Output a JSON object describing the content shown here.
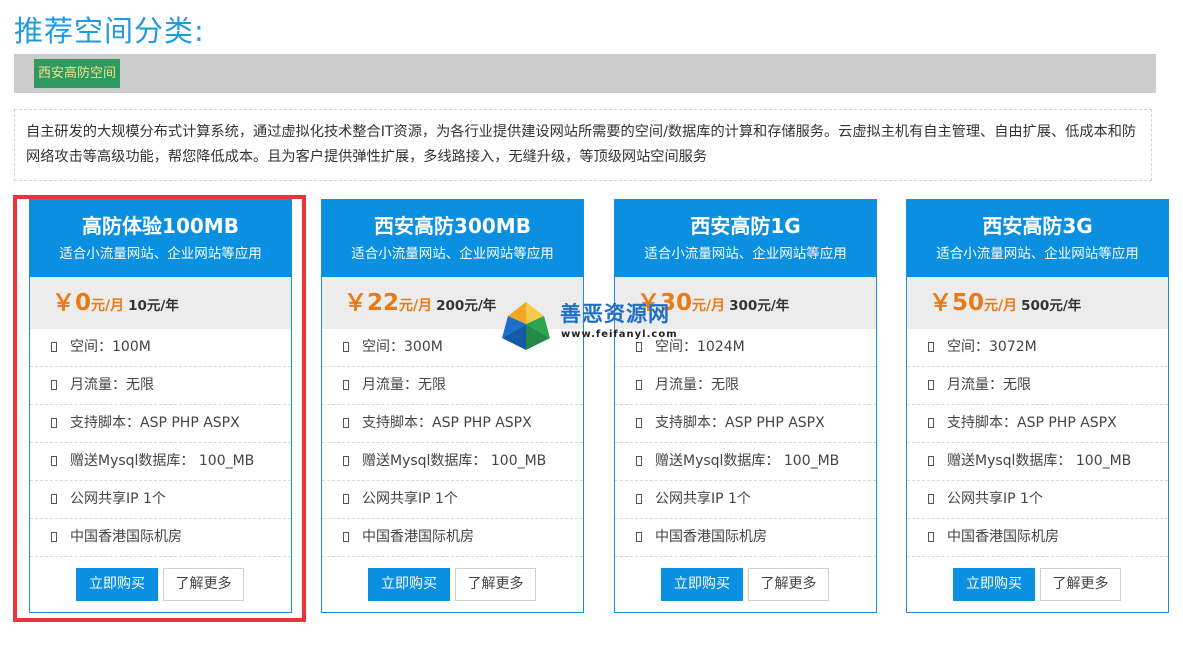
{
  "page_title": "推荐空间分类:",
  "tabs": [
    {
      "label": "西安高防空间",
      "active": true
    }
  ],
  "description": "自主研发的大规模分布式计算系统，通过虚拟化技术整合IT资源，为各行业提供建设网站所需要的空间/数据库的计算和存储服务。云虚拟主机有自主管理、自由扩展、低成本和防网络攻击等高级功能，帮您降低成本。且为客户提供弹性扩展，多线路接入，无缝升级，等顶级网站空间服务",
  "plans": [
    {
      "title": "高防体验100MB",
      "subtitle": "适合小流量网站、企业网站等应用",
      "price": "￥0",
      "price_unit": "元/月",
      "price_year": "10元/年",
      "features": [
        "空间：100M",
        "月流量：无限",
        "支持脚本：ASP PHP ASPX",
        "赠送Mysql数据库： 100_MB",
        "公网共享IP 1个",
        "中国香港国际机房"
      ],
      "buy_label": "立即购买",
      "more_label": "了解更多",
      "highlighted": true
    },
    {
      "title": "西安高防300MB",
      "subtitle": "适合小流量网站、企业网站等应用",
      "price": "￥22",
      "price_unit": "元/月",
      "price_year": "200元/年",
      "features": [
        "空间：300M",
        "月流量：无限",
        "支持脚本：ASP PHP ASPX",
        "赠送Mysql数据库： 100_MB",
        "公网共享IP 1个",
        "中国香港国际机房"
      ],
      "buy_label": "立即购买",
      "more_label": "了解更多"
    },
    {
      "title": "西安高防1G",
      "subtitle": "适合小流量网站、企业网站等应用",
      "price": "￥30",
      "price_unit": "元/月",
      "price_year": "300元/年",
      "features": [
        "空间：1024M",
        "月流量：无限",
        "支持脚本：ASP PHP ASPX",
        "赠送Mysql数据库： 100_MB",
        "公网共享IP 1个",
        "中国香港国际机房"
      ],
      "buy_label": "立即购买",
      "more_label": "了解更多"
    },
    {
      "title": "西安高防3G",
      "subtitle": "适合小流量网站、企业网站等应用",
      "price": "￥50",
      "price_unit": "元/月",
      "price_year": "500元/年",
      "features": [
        "空间：3072M",
        "月流量：无限",
        "支持脚本：ASP PHP ASPX",
        "赠送Mysql数据库： 100_MB",
        "公网共享IP 1个",
        "中国香港国际机房"
      ],
      "buy_label": "立即购买",
      "more_label": "了解更多"
    }
  ],
  "watermark": {
    "text": "善恶资源网",
    "url": "www.feifanyl.com"
  },
  "colors": {
    "title": "#1f9be0",
    "card_header": "#0b8fe1",
    "price": "#e97b17",
    "tab_bg": "#2f9a60",
    "tab_text": "#f3e08a",
    "highlight_border": "#e8343c"
  }
}
